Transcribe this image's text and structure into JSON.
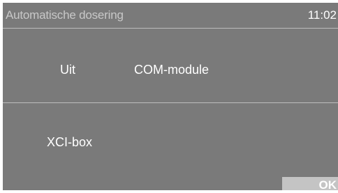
{
  "header": {
    "title": "Automatische dosering",
    "time": "11:02"
  },
  "options": {
    "row1": [
      "Uit",
      "COM-module"
    ],
    "row2": [
      "XCI-box"
    ]
  },
  "footer": {
    "ok_label": "OK"
  },
  "colors": {
    "background": "#7a7a7a",
    "title_text": "#c8c8c8",
    "divider": "#bdbdbd",
    "ok_button": "#c4c4c4",
    "text": "#ffffff"
  }
}
